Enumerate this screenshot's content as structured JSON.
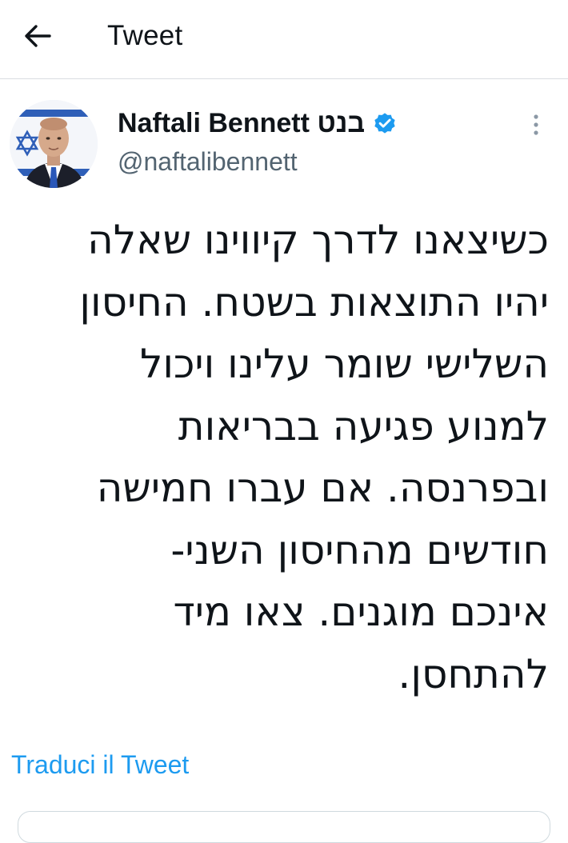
{
  "header": {
    "back_icon": "arrow-left-icon",
    "title": "Tweet"
  },
  "tweet": {
    "author": {
      "name": "Naftali Bennett בנט",
      "handle": "@naftalibennett",
      "verified": true,
      "verified_icon": "verified-badge-icon"
    },
    "more_icon": "more-vertical-icon",
    "text_lines": [
      "כשיצאנו לדרך קיווינו שאלה",
      "יהיו התוצאות בשטח. החיסון",
      "השלישי שומר עלינו ויכול",
      "למנוע פגיעה בבריאות",
      "ובפרנסה. אם עברו חמישה",
      "חודשים מהחיסון השני-",
      "אינכם מוגנים. צאו מיד",
      "להתחסן."
    ],
    "translate_label": "Traduci il Tweet"
  },
  "colors": {
    "accent": "#1d9bf0",
    "text_primary": "#0f1419",
    "text_secondary": "#536471",
    "divider": "#d9dde1"
  }
}
